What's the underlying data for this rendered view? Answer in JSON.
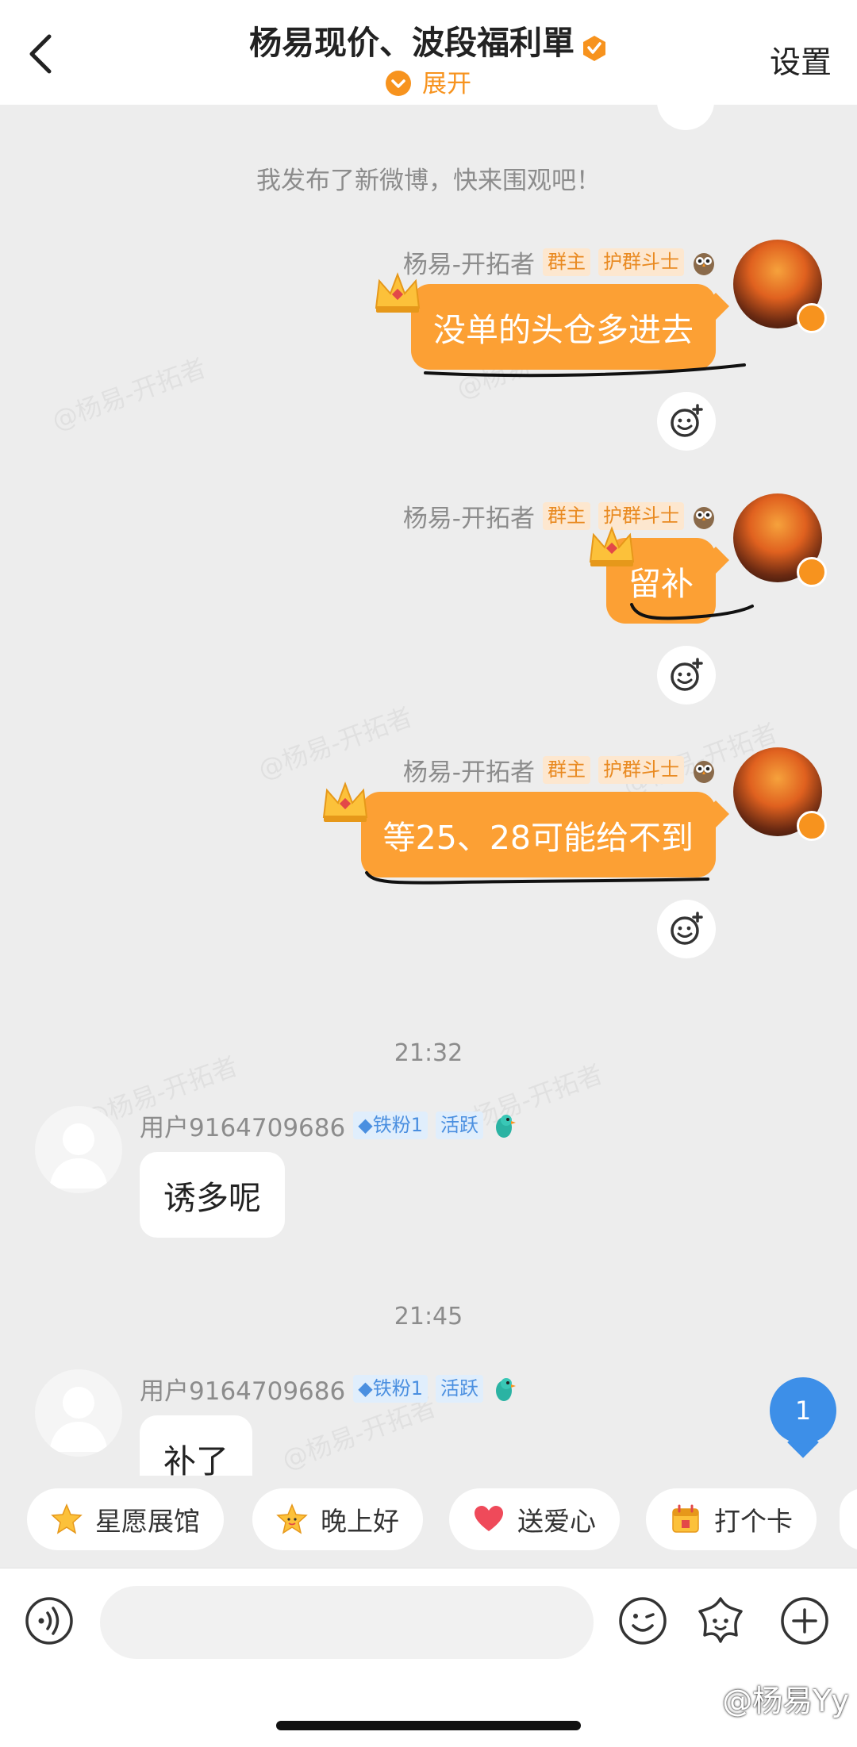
{
  "header": {
    "title": "杨易现价、波段福利單",
    "subtitle": "展开",
    "settings_label": "设置"
  },
  "chat": {
    "system_message": "我发布了新微博，快来围观吧！",
    "watermark_text": "@杨易-开拓者",
    "owner": {
      "name": "杨易-开拓者",
      "tag_owner": "群主",
      "tag_guard": "护群斗士"
    },
    "owner_messages": [
      {
        "text": "没单的头仓多进去"
      },
      {
        "text": "留补"
      },
      {
        "text": "等25、28可能给不到"
      }
    ],
    "timestamps": [
      "21:32",
      "21:45"
    ],
    "member": {
      "name": "用户9164709686",
      "tag_fan": "铁粉1",
      "tag_active": "活跃"
    },
    "member_messages": [
      {
        "text": "诱多呢"
      },
      {
        "text": "补了"
      }
    ],
    "unread_count": "1"
  },
  "quick_chips": [
    {
      "label": "星愿展馆",
      "icon": "star-icon"
    },
    {
      "label": "晚上好",
      "icon": "smiling-star-icon"
    },
    {
      "label": "送爱心",
      "icon": "heart-icon"
    },
    {
      "label": "打个卡",
      "icon": "calendar-icon"
    }
  ],
  "input_bar": {
    "placeholder": "",
    "icons": [
      "voice-icon",
      "emoji-icon",
      "sticker-icon",
      "plus-icon"
    ]
  },
  "footer_watermark": "@杨易Yy",
  "colors": {
    "accent_orange": "#fca034",
    "badge_blue": "#3d8fe8",
    "background": "#ededed"
  }
}
